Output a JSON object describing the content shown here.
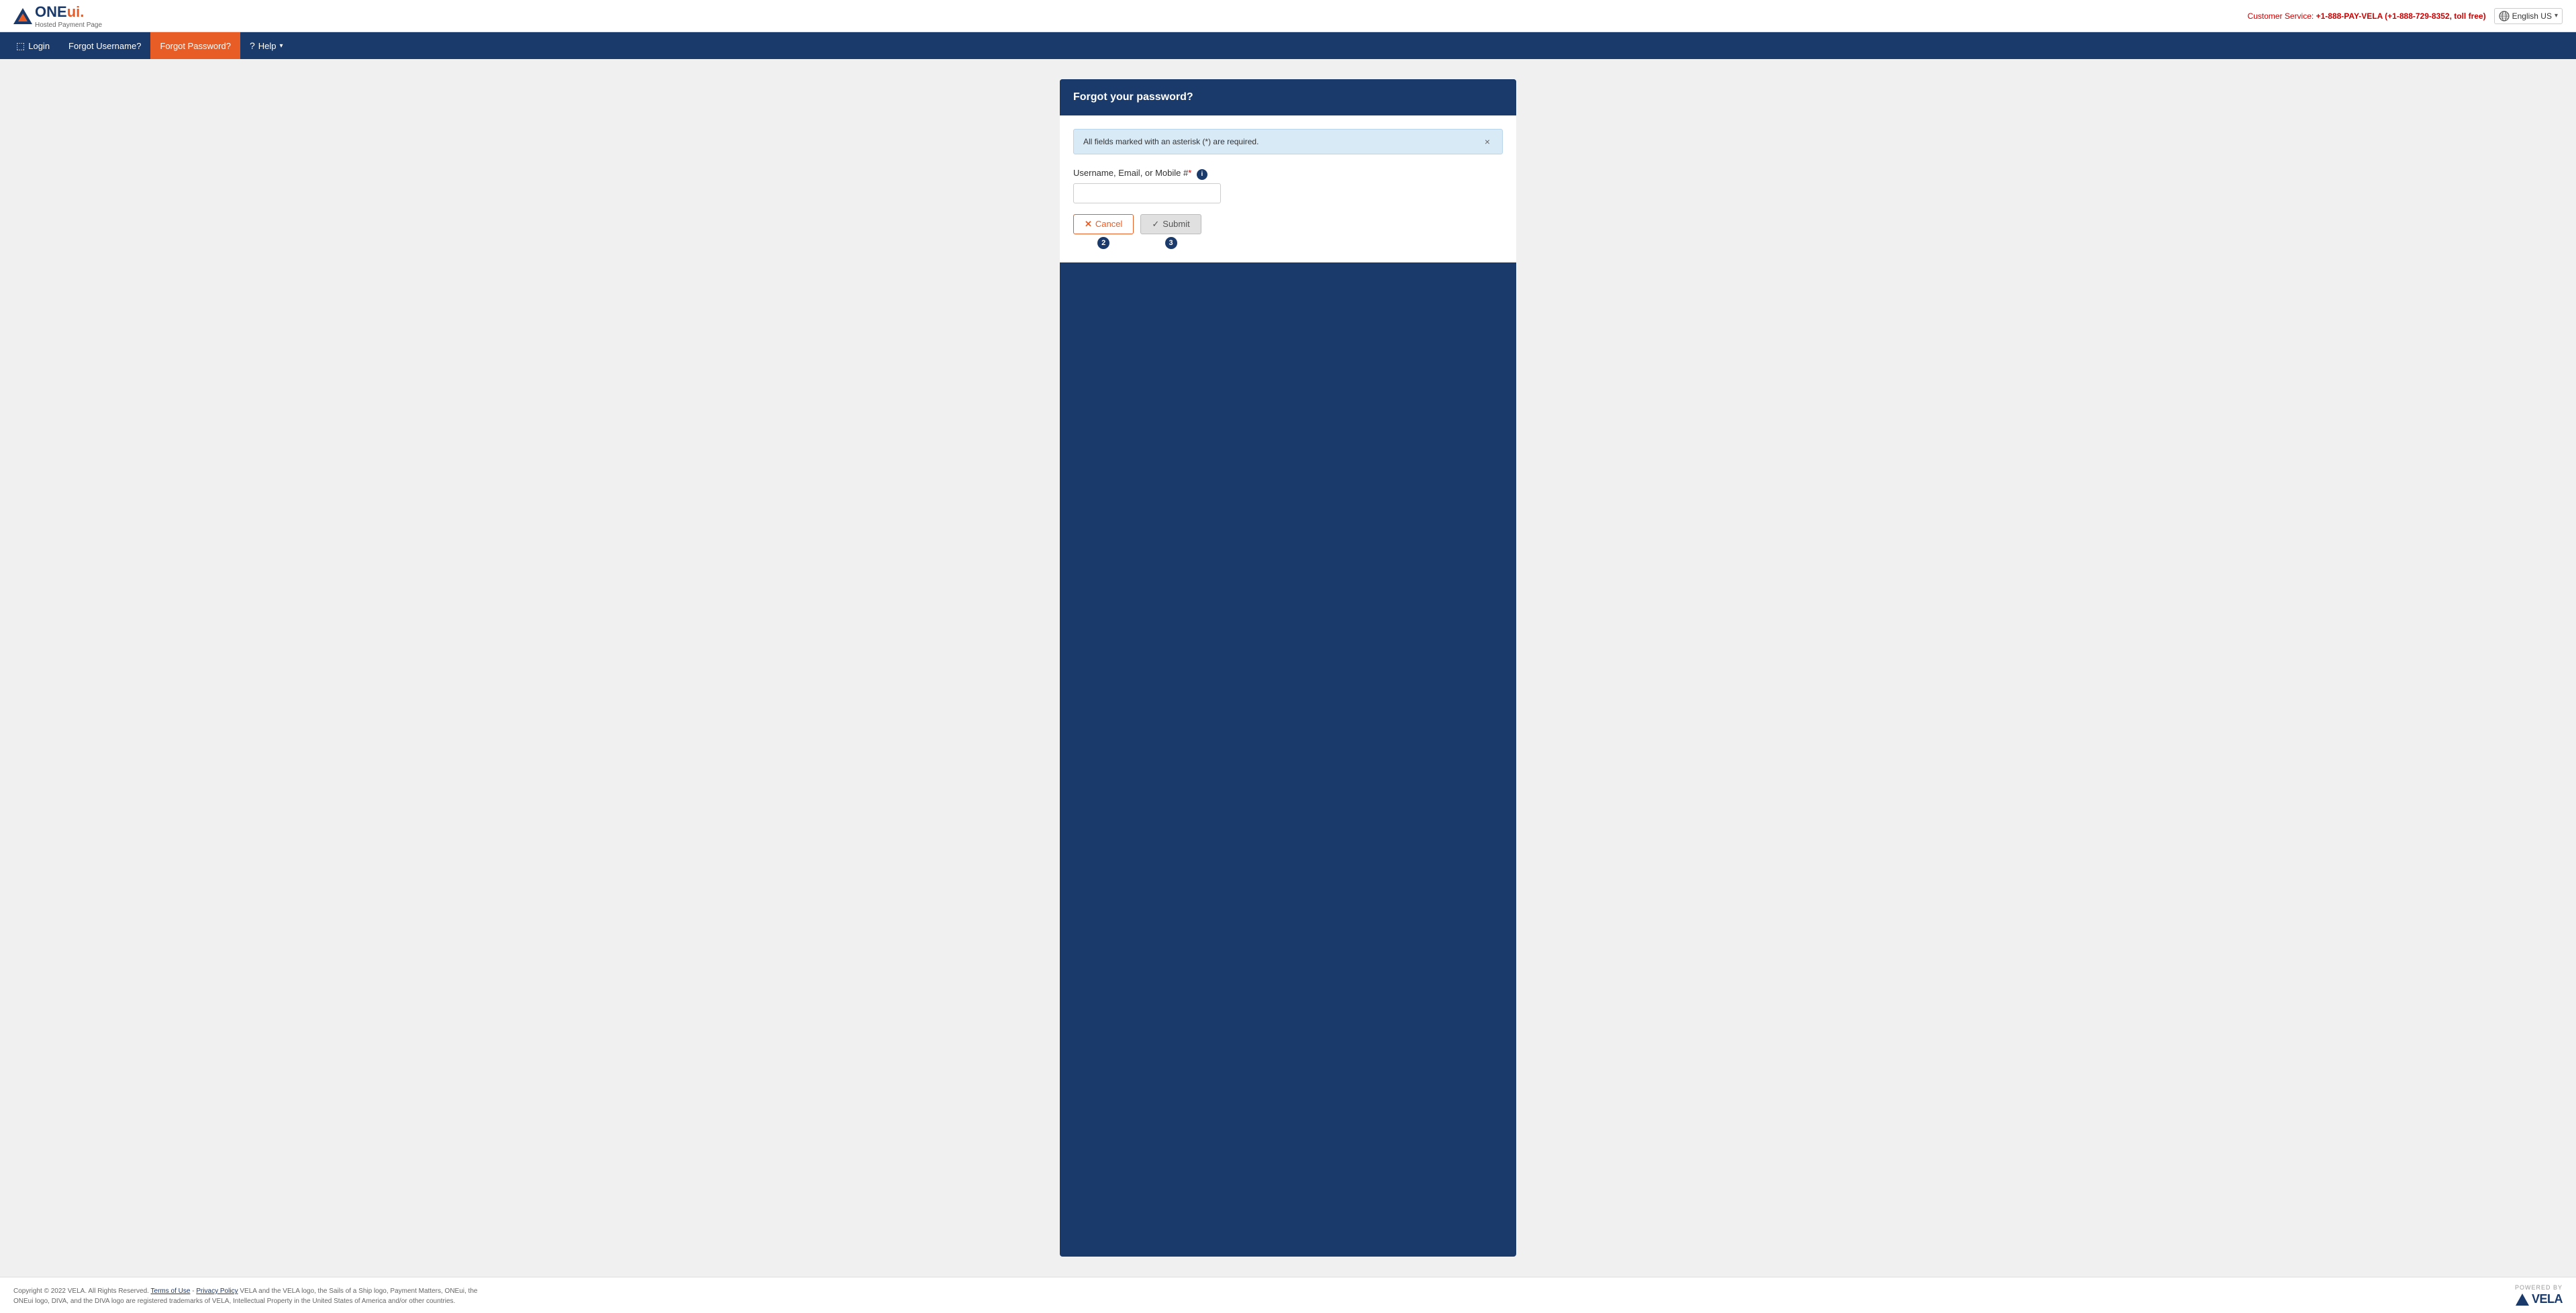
{
  "header": {
    "logo_main": "ONE",
    "logo_ui": "ui.",
    "logo_subtitle": "Hosted Payment Page",
    "customer_service_label": "Customer Service:",
    "customer_service_phone": "+1-888-PAY-VELA (+1-888-729-8352, toll free)",
    "lang_label": "English US"
  },
  "nav": {
    "login_label": "Login",
    "forgot_username_label": "Forgot Username?",
    "forgot_password_label": "Forgot Password?",
    "help_label": "Help"
  },
  "form": {
    "title": "Forgot your password?",
    "alert_message": "All fields marked with an asterisk (*) are required.",
    "field_label": "Username, Email, or Mobile #",
    "field_placeholder": "",
    "cancel_label": "Cancel",
    "submit_label": "Submit",
    "step_cancel": "2",
    "step_submit": "3",
    "info_icon_label": "i"
  },
  "footer": {
    "copyright": "Copyright © 2022 VELA. All Rights Reserved.",
    "terms_label": "Terms of Use",
    "privacy_label": "Privacy Policy",
    "trademark_text": "VELA and the VELA logo, the Sails of a Ship logo, Payment Matters, ONEui, the ONEui logo, DIVA, and the DIVA logo are registered trademarks of VELA, Intellectual Property in the United States of America and/or other countries.",
    "powered_by": "POWERED BY",
    "vela_name": "VELA"
  }
}
